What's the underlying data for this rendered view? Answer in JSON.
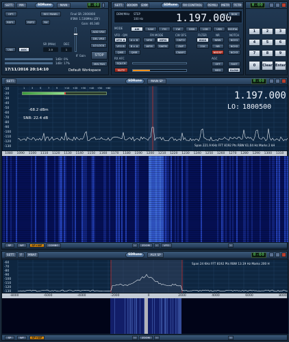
{
  "main": {
    "sett": "SETT.",
    "ma": "MA",
    "logo": "SDRuno",
    "title": "MAIN",
    "lcd": "0-00",
    "opt": "OPT.",
    "rec_panel": "REC PANEL",
    "rsp1": "RSP1",
    "rsp2": "RSP2",
    "rx": "RX",
    "final_sr": "Final SR: 2000000",
    "ifbw": "IFBW: 1.536MHz (ZIF)",
    "gain": "Gain: 46.3dB",
    "add_vrx": "ADD VRX",
    "del_vrx": "DEL VRX",
    "lo_lock": "LO LOCK",
    "lna": "LNA",
    "agc": "AGC",
    "sr_mhz": "SR (MHz)",
    "dec": "DEC",
    "sr_val": "2.0",
    "dec_val": "1",
    "if_gain": "IF Gain",
    "stop": "STOP",
    "min_pan": "MIN PAN",
    "db": "1dBr: 0%",
    "dbr": "1dBr: 17%",
    "datetime": "17/11/2016 20:14:10",
    "workspace": "Default Workspace"
  },
  "rx": {
    "sett": "SETT.",
    "bookm": "BOOKM",
    "exm": "EXM",
    "logo": "SDRuno",
    "title": "RX CONTROL",
    "rsykl": "RSYKLI",
    "metr": "METR",
    "tctr": "TCTR",
    "lcd": "0-00",
    "dbm_label": "DBM/MHz",
    "step_label": "STEP",
    "step_val": "100 Hz",
    "freq": "1.197.000",
    "level": "-68.2 dBm",
    "bkw": "BKW",
    "mode": "MODE",
    "modes": [
      "AM",
      "SAM",
      "FM",
      "CW",
      "DSB",
      "LSB",
      "USB",
      "DIGITAL"
    ],
    "vfo_qm": "VFO - QM",
    "fm_mode": "FM MODE",
    "cw_ofs": "CW OFS",
    "filter": "FILTER",
    "nr": "NR",
    "notch": "NOTCH",
    "vfo_a": "VFO A",
    "a_b": "A > B",
    "nfm": "NFM",
    "mfm": "MFM",
    "cw": "CWTO",
    "f4k": "6000",
    "nbw": "NBW",
    "nbw2": "NCH1",
    "vfo_b": "VFO B",
    "b_a": "B > A",
    "wfm": "WFM",
    "swfm": "SWFM",
    "zap": "ZAP",
    "f21k": "21K",
    "nb": "NB",
    "nch2": "NCH2",
    "qms": "QMS",
    "qmr": "QMR",
    "cwafc": "CWAFC",
    "nbdsp": "NBDSP",
    "nch3": "NCH3",
    "rx_afc": "RX AFC",
    "squelch": "SQLCH",
    "mute": "MUTE",
    "agc": "AGC",
    "off": "OFF",
    "fast": "FAST",
    "med": "MED",
    "slow": "SLOW",
    "volume_pct": 0.32
  },
  "keypad": {
    "lcd": "0-00",
    "keys": [
      "1",
      "2",
      "3",
      "4",
      "5",
      "6",
      "7",
      "8",
      "9",
      "0",
      "Clear",
      "Enter"
    ],
    "side": [
      "1Hz",
      "1KHz",
      "MHz",
      "Hz",
      "kHz",
      "MHz"
    ]
  },
  "sp": {
    "sett": "SETT.",
    "logo": "SDRuno",
    "title": "MAIN SP",
    "lcd": "0-00",
    "freq": "1.197.000",
    "lo": "LO:",
    "lo_val": "1800500",
    "level": "-68.2 dBm",
    "snr": "SNR: 22.4 dB",
    "smeter": [
      "1",
      "3",
      "5",
      "7",
      "9",
      "+10",
      "+20",
      "+30",
      "+40",
      "+50",
      "+60"
    ],
    "info": "Span 221.9 KHz   FFT 8192 Pts   RBW 61.04 Hz   Marks 2 kH",
    "db_ticks": [
      "-10",
      "-20",
      "-30",
      "-40",
      "-50",
      "-60",
      "-70",
      "-80",
      "-90",
      "-100",
      "-110",
      "-120",
      "-130"
    ],
    "x_ticks": [
      "1080",
      "1090",
      "1100",
      "1110",
      "1120",
      "1130",
      "1140",
      "1150",
      "1160",
      "1170",
      "1180",
      "1190",
      "1200",
      "1210",
      "1220",
      "1230",
      "1240",
      "1250",
      "1260",
      "1270",
      "1280",
      "1290",
      "1300",
      "1310"
    ],
    "b_sp": "SP",
    "b_wf": "WF",
    "b_spwf": "SP+WF",
    "b_combo": "COMBO",
    "zoom": "ZOOM",
    "b_vfo": "VFO",
    "i": "i"
  },
  "aux": {
    "sett": "SETT.",
    "f": "F",
    "mnaf": "MNAF",
    "logo": "SDRuno",
    "title": "AUX SP",
    "lcd": "0-00",
    "info": "Span 24 KHz   FFT 8192 Pts   RBW 13.19 Hz   Marks 200 H",
    "db_ticks": [
      "-60",
      "-70",
      "-80",
      "-90",
      "-100",
      "-110",
      "-120",
      "-130"
    ],
    "x_ticks": [
      "-8000",
      "-6000",
      "-4000",
      "-2000",
      "0",
      "2000",
      "4000",
      "6000",
      "8000"
    ],
    "b_sp": "SP",
    "b_wf": "WF",
    "b_spwf": "SP+WF",
    "zoom": "ZOOM",
    "i": "i"
  }
}
